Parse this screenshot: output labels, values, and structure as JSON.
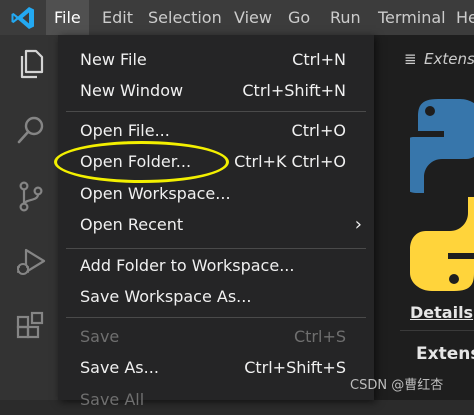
{
  "menubar": {
    "items": [
      "File",
      "Edit",
      "Selection",
      "View",
      "Go",
      "Run",
      "Terminal",
      "He"
    ]
  },
  "file_menu": {
    "groups": [
      [
        {
          "label": "New File",
          "shortcut": "Ctrl+N"
        },
        {
          "label": "New Window",
          "shortcut": "Ctrl+Shift+N"
        }
      ],
      [
        {
          "label": "Open File...",
          "shortcut": "Ctrl+O"
        },
        {
          "label": "Open Folder...",
          "shortcut": "Ctrl+K Ctrl+O"
        },
        {
          "label": "Open Workspace...",
          "shortcut": ""
        },
        {
          "label": "Open Recent",
          "shortcut": "",
          "submenu": true
        }
      ],
      [
        {
          "label": "Add Folder to Workspace...",
          "shortcut": ""
        },
        {
          "label": "Save Workspace As...",
          "shortcut": ""
        }
      ],
      [
        {
          "label": "Save",
          "shortcut": "Ctrl+S",
          "disabled": true
        },
        {
          "label": "Save As...",
          "shortcut": "Ctrl+Shift+S"
        },
        {
          "label": "Save All",
          "shortcut": "",
          "disabled": true
        }
      ]
    ],
    "highlighted_item": "Open Folder..."
  },
  "activity_bar": {
    "icons": [
      "explorer-icon",
      "search-icon",
      "source-control-icon",
      "run-debug-icon",
      "extensions-icon"
    ]
  },
  "editor": {
    "tab_label": "Extensi",
    "details_link": "Details",
    "section_heading": "Extens"
  },
  "watermark": "CSDN @曹红杏",
  "colors": {
    "highlight_ellipse": "#f3f000",
    "vscode_blue": "#23a9f2",
    "python_blue": "#3776ab",
    "python_yellow": "#ffd43b"
  }
}
